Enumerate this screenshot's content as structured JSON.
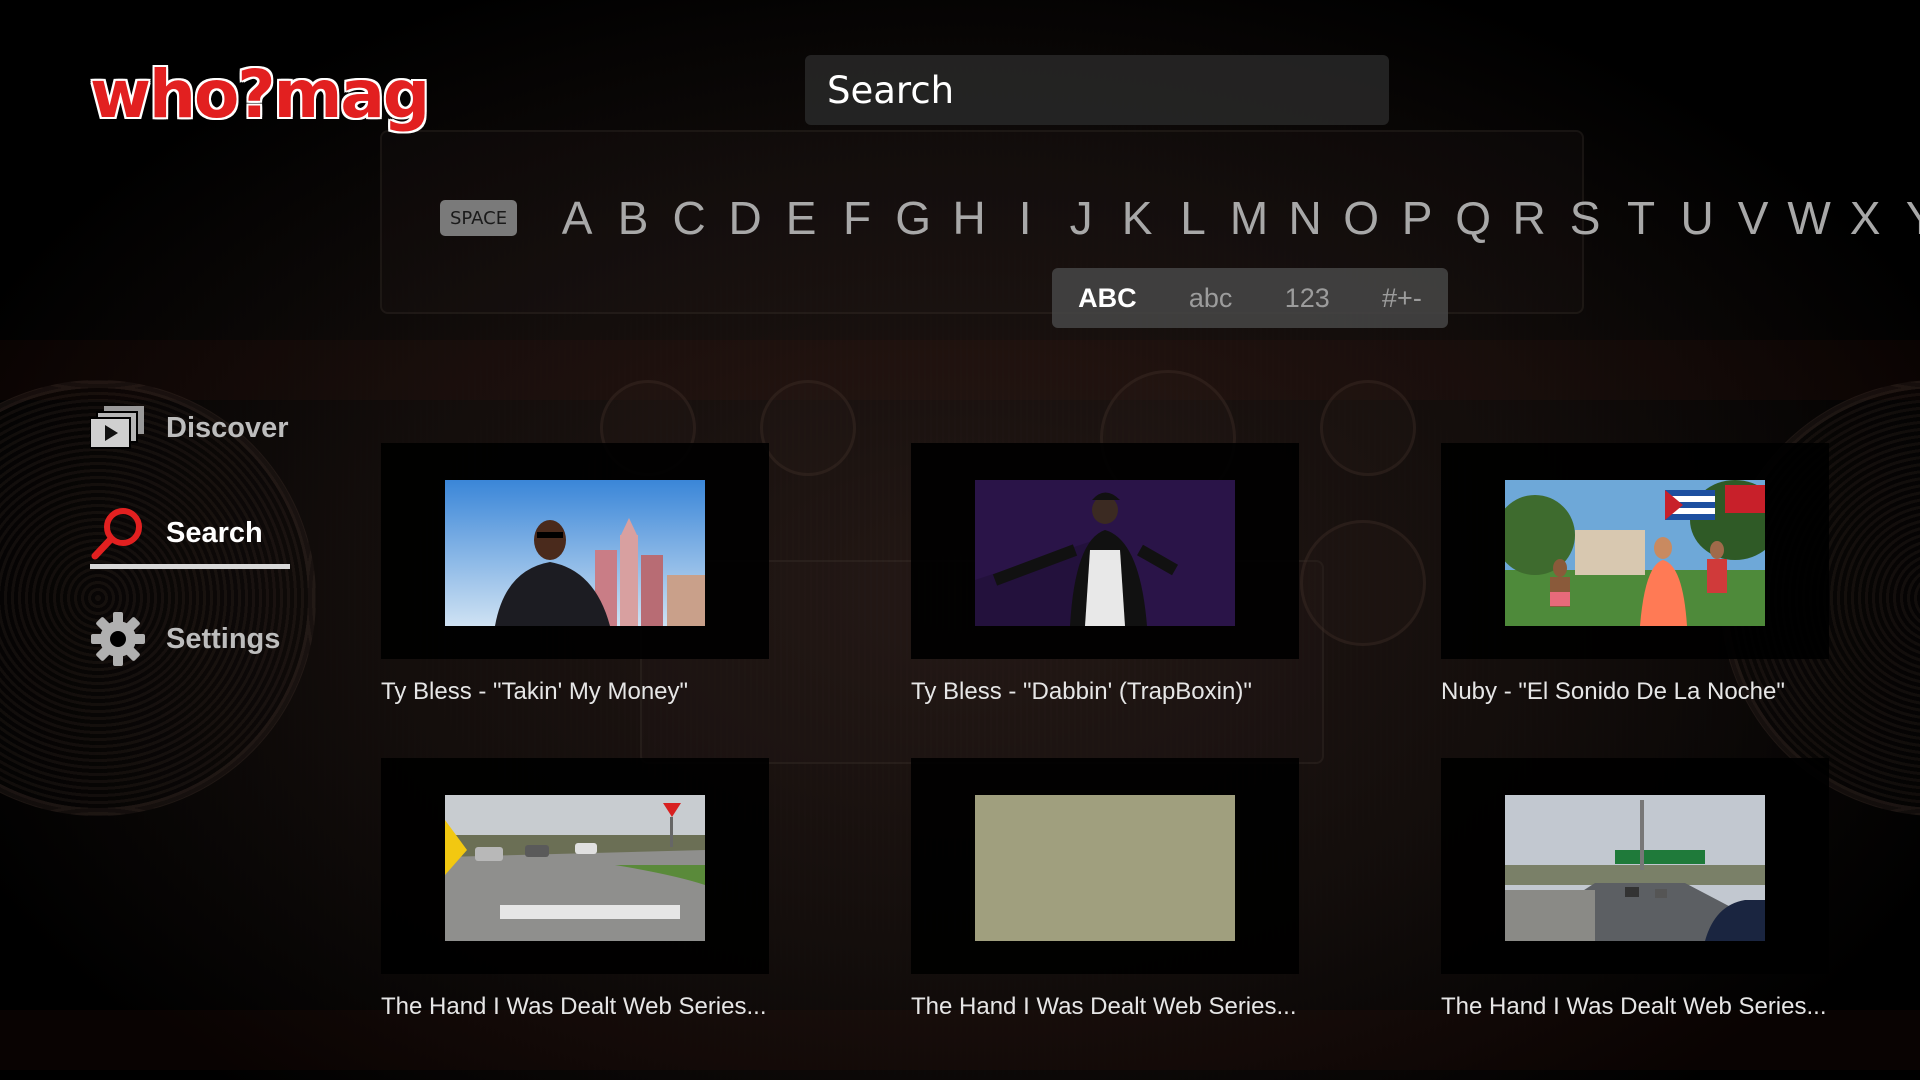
{
  "app": {
    "logo_text": "who?mag"
  },
  "search": {
    "label": "Search"
  },
  "keyboard": {
    "space_label": "SPACE",
    "keys": [
      "A",
      "B",
      "C",
      "D",
      "E",
      "F",
      "G",
      "H",
      "I",
      "J",
      "K",
      "L",
      "M",
      "N",
      "O",
      "P",
      "Q",
      "R",
      "S",
      "T",
      "U",
      "V",
      "W",
      "X",
      "Y"
    ]
  },
  "modes": [
    {
      "label": "ABC",
      "active": true
    },
    {
      "label": "abc",
      "active": false
    },
    {
      "label": "123",
      "active": false
    },
    {
      "label": "#+-",
      "active": false
    }
  ],
  "sidebar": {
    "items": [
      {
        "label": "Discover",
        "icon": "discover-icon"
      },
      {
        "label": "Search",
        "icon": "search-icon",
        "active": true
      },
      {
        "label": "Settings",
        "icon": "gear-icon"
      }
    ]
  },
  "results": [
    {
      "title": "Ty Bless - \"Takin' My Money\""
    },
    {
      "title": "Ty Bless - \"Dabbin' (TrapBoxin)\""
    },
    {
      "title": "Nuby - \"El Sonido De La Noche\""
    },
    {
      "title": "The Hand I Was Dealt Web Series..."
    },
    {
      "title": "The Hand I Was Dealt Web Series..."
    },
    {
      "title": "The Hand I Was Dealt Web Series..."
    }
  ],
  "colors": {
    "brand": "#e22020",
    "accent_underline": "#d8d8d8"
  }
}
